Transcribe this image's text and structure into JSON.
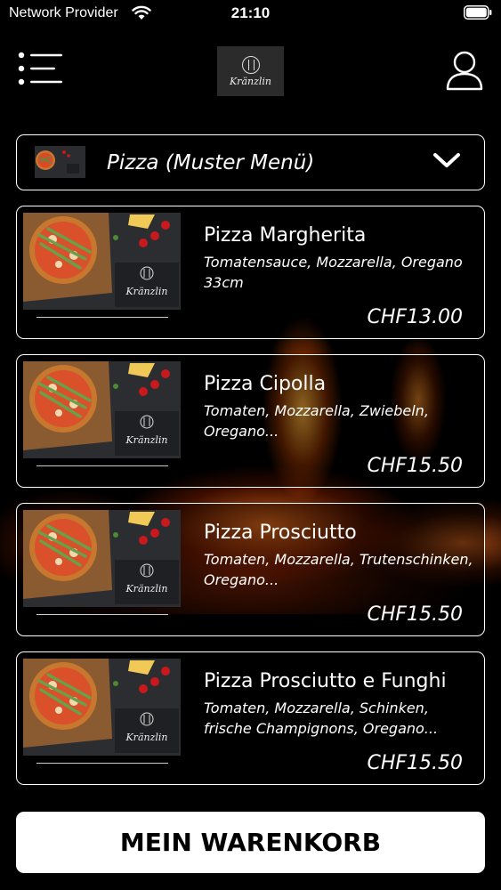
{
  "status_bar": {
    "carrier": "Network Provider",
    "time": "21:10",
    "icons": [
      "wifi-icon",
      "battery-icon"
    ]
  },
  "header": {
    "logo_text": "Kränzlin",
    "icons": [
      "menu-icon",
      "user-icon"
    ]
  },
  "category": {
    "selected": "Pizza (Muster Menü)",
    "icon": "chevron-down-icon"
  },
  "products": [
    {
      "name": "Pizza Margherita",
      "description": "Tomatensauce, Mozzarella, Oregano 33cm",
      "price": "CHF13.00",
      "image_logo_text": "Kränzlin"
    },
    {
      "name": "Pizza Cipolla",
      "description": "Tomaten, Mozzarella, Zwiebeln, Oregano...",
      "price": "CHF15.50",
      "image_logo_text": "Kränzlin"
    },
    {
      "name": "Pizza Prosciutto",
      "description": "Tomaten, Mozzarella, Trutenschinken, Oregano...",
      "price": "CHF15.50",
      "image_logo_text": "Kränzlin"
    },
    {
      "name": "Pizza Prosciutto e Funghi",
      "description": "Tomaten, Mozzarella, Schinken, frische Champignons, Oregano...",
      "price": "CHF15.50",
      "image_logo_text": "Kränzlin"
    }
  ],
  "cart": {
    "label": "MEIN WARENKORB"
  },
  "colors": {
    "background": "#000000",
    "foreground": "#ffffff",
    "button_bg": "#ffffff",
    "button_text": "#000000"
  }
}
